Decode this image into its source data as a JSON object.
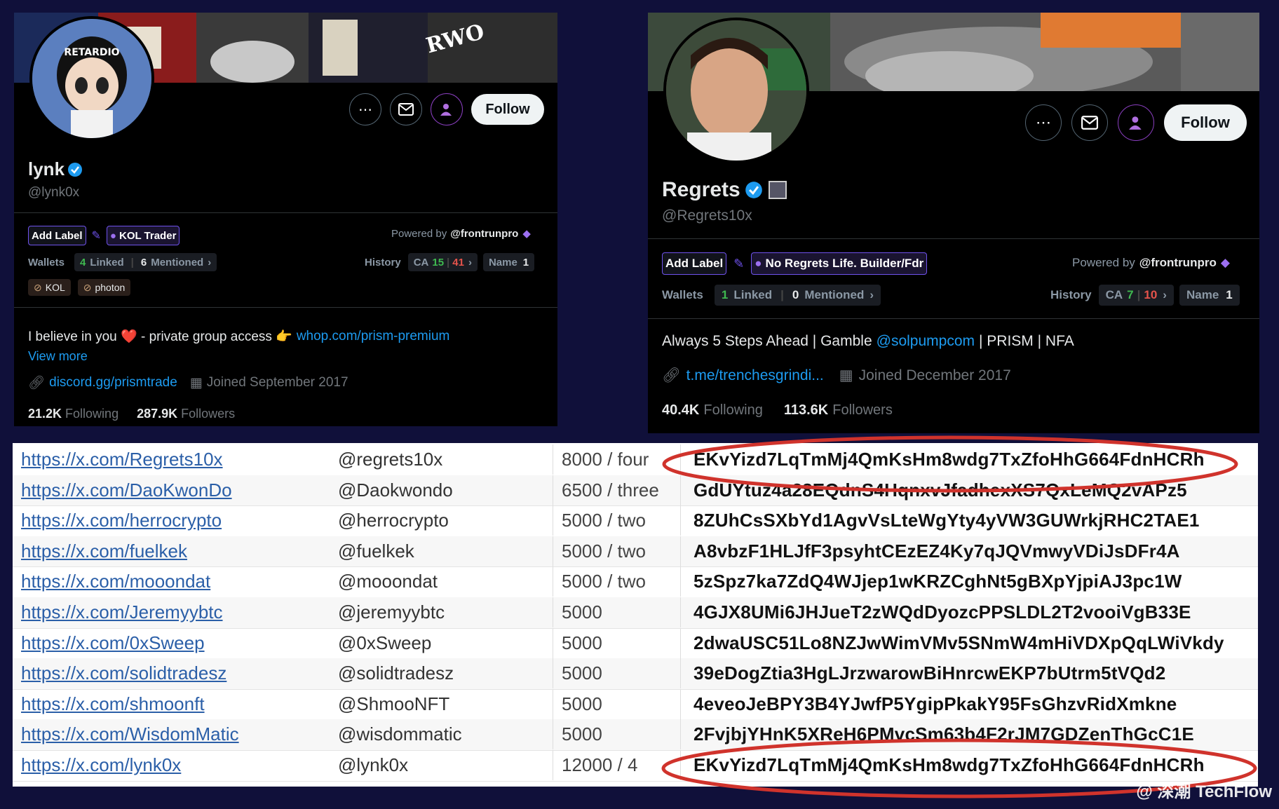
{
  "profile_left": {
    "name": "lynk",
    "handle": "@lynk0x",
    "follow_label": "Follow",
    "add_label": "Add Label",
    "kol_label": "KOL Trader",
    "powered_by": "Powered by",
    "powered_handle": "@frontrunpro",
    "wallets_label": "Wallets",
    "linked_count": "4",
    "linked_label": "Linked",
    "mentioned_count": "6",
    "mentioned_label": "Mentioned",
    "history_label": "History",
    "ca_label": "CA",
    "ca_a": "15",
    "ca_b": "41",
    "name_label": "Name",
    "name_count": "1",
    "tag1": "KOL",
    "tag2": "photon",
    "bio_prefix": "I believe in you ❤️ - private group access 👉",
    "bio_link": "whop.com/prism-premium",
    "view_more": "View more",
    "url": "discord.gg/prismtrade",
    "joined": "Joined September 2017",
    "following_count": "21.2K",
    "following_label": "Following",
    "followers_count": "287.9K",
    "followers_label": "Followers",
    "avatar_text": "RETARDIO"
  },
  "profile_right": {
    "name": "Regrets",
    "handle": "@Regrets10x",
    "follow_label": "Follow",
    "add_label": "Add Label",
    "kol_label": "No Regrets Life. Builder/Fdr",
    "powered_by": "Powered by",
    "powered_handle": "@frontrunpro",
    "wallets_label": "Wallets",
    "linked_count": "1",
    "linked_label": "Linked",
    "mentioned_count": "0",
    "mentioned_label": "Mentioned",
    "history_label": "History",
    "ca_label": "CA",
    "ca_a": "7",
    "ca_b": "10",
    "name_label": "Name",
    "name_count": "1",
    "bio_prefix": "Always 5 Steps Ahead | Gamble",
    "bio_mention": "@solpumpcom",
    "bio_suffix": "| PRISM | NFA",
    "url": "t.me/trenchesgrindi...",
    "joined": "Joined December 2017",
    "following_count": "40.4K",
    "following_label": "Following",
    "followers_count": "113.6K",
    "followers_label": "Followers"
  },
  "table": [
    {
      "url": "https://x.com/Regrets10x",
      "handle": "@regrets10x",
      "amount": "8000 / four",
      "address": "EKvYizd7LqTmMj4QmKsHm8wdg7TxZfoHhG664FdnHCRh"
    },
    {
      "url": "https://x.com/DaoKwonDo",
      "handle": "@Daokwondo",
      "amount": "6500 / three",
      "address": "GdUYtuz4a28EQdnS4HqnxvJfadhexXS7QxLeMQ2vAPz5"
    },
    {
      "url": "https://x.com/herrocrypto",
      "handle": "@herrocrypto",
      "amount": "5000 / two",
      "address": "8ZUhCsSXbYd1AgvVsLteWgYty4yVW3GUWrkjRHC2TAE1"
    },
    {
      "url": "https://x.com/fuelkek",
      "handle": "@fuelkek",
      "amount": "5000 / two",
      "address": "A8vbzF1HLJfF3psyhtCEzEZ4Ky7qJQVmwyVDiJsDFr4A"
    },
    {
      "url": "https://x.com/mooondat",
      "handle": "@mooondat",
      "amount": "5000 / two",
      "address": "5zSpz7ka7ZdQ4WJjep1wKRZCghNt5gBXpYjpiAJ3pc1W"
    },
    {
      "url": "https://x.com/Jeremyybtc",
      "handle": "@jeremyybtc",
      "amount": "5000",
      "address": "4GJX8UMi6JHJueT2zWQdDyozcPPSLDL2T2vooiVgB33E"
    },
    {
      "url": "https://x.com/0xSweep",
      "handle": "@0xSweep",
      "amount": "5000",
      "address": "2dwaUSC51Lo8NZJwWimVMv5SNmW4mHiVDXpQqLWiVkdy"
    },
    {
      "url": "https://x.com/solidtradesz",
      "handle": "@solidtradesz",
      "amount": "5000",
      "address": "39eDogZtia3HgLJrzwarowBiHnrcwEKP7bUtrm5tVQd2"
    },
    {
      "url": "https://x.com/shmoonft",
      "handle": "@ShmooNFT",
      "amount": "5000",
      "address": "4eveoJeBPY3B4YJwfP5YgipPkakY95FsGhzvRidXmkne"
    },
    {
      "url": "https://x.com/WisdomMatic",
      "handle": "@wisdommatic",
      "amount": "5000",
      "address": "2FvjbjYHnK5XReH6PMvcSm63b4F2rJM7GDZenThGcC1E"
    },
    {
      "url": "https://x.com/lynk0x",
      "handle": "@lynk0x",
      "amount": "12000 / 4",
      "address": "EKvYizd7LqTmMj4QmKsHm8wdg7TxZfoHhG664FdnHCRh"
    }
  ],
  "watermark": "@ 深潮 TechFlow",
  "colors": {
    "highlight_ellipse": "#d0332c",
    "accent_purple": "#6f52ed",
    "link_blue": "#1d9bf0"
  }
}
